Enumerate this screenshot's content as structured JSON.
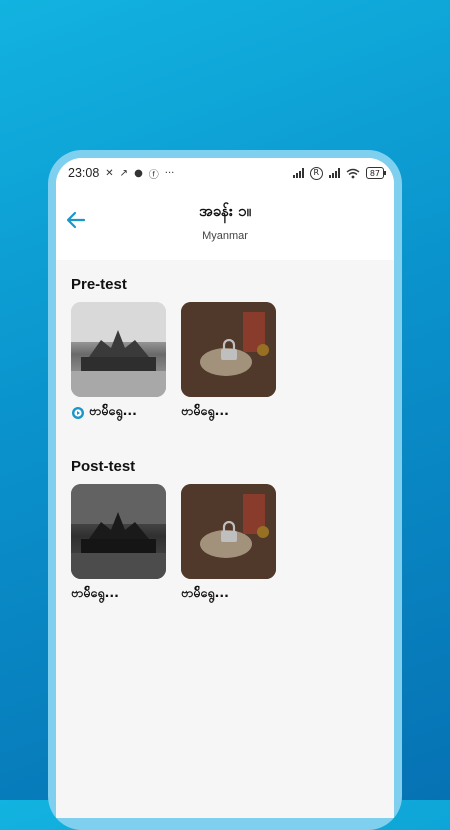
{
  "status_bar": {
    "time": "23:08",
    "battery": "87"
  },
  "header": {
    "title": "အခန်း ၁။",
    "subtitle": "Myanmar"
  },
  "sections": [
    {
      "title": "Pre-test",
      "items": [
        {
          "label": "ဗာမ်ိရွေ...",
          "locked": false,
          "playable": true,
          "image": "building"
        },
        {
          "label": "ဗာမ်ိရွေ...",
          "locked": true,
          "playable": false,
          "image": "painting"
        }
      ]
    },
    {
      "title": "Post-test",
      "items": [
        {
          "label": "ဗာမ်ိရွေ...",
          "locked": true,
          "playable": false,
          "image": "building"
        },
        {
          "label": "ဗာမ်ိရွေ...",
          "locked": true,
          "playable": false,
          "image": "painting"
        }
      ]
    }
  ],
  "colors": {
    "accent": "#1a96c9",
    "background_gradient_start": "#12b3e0",
    "background_gradient_end": "#0672b4"
  },
  "icons": {
    "back": "arrow-left-icon",
    "lock": "lock-icon",
    "play": "play-icon"
  }
}
